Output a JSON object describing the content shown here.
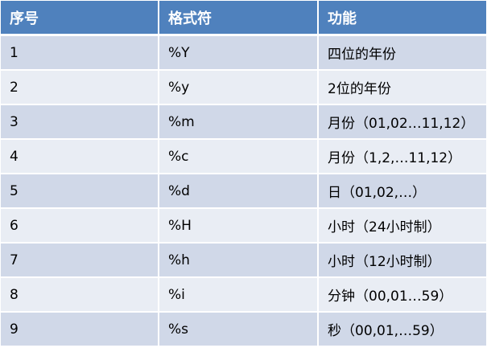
{
  "table": {
    "headers": [
      "序号",
      "格式符",
      "功能"
    ],
    "rows": [
      [
        "1",
        "%Y",
        "四位的年份"
      ],
      [
        "2",
        "%y",
        "2位的年份"
      ],
      [
        "3",
        "%m",
        "月份（01,02…11,12）"
      ],
      [
        "4",
        "%c",
        "月份（1,2,…11,12）"
      ],
      [
        "5",
        "%d",
        "日（01,02,…）"
      ],
      [
        "6",
        "%H",
        "小时（24小时制）"
      ],
      [
        "7",
        "%h",
        "小时（12小时制）"
      ],
      [
        "8",
        "%i",
        "分钟（00,01…59）"
      ],
      [
        "9",
        "%s",
        "秒（00,01,…59）"
      ]
    ]
  },
  "colors": {
    "header_bg": "#4f81bd",
    "row_odd_bg": "#d0d8e8",
    "row_even_bg": "#e9edf4"
  }
}
